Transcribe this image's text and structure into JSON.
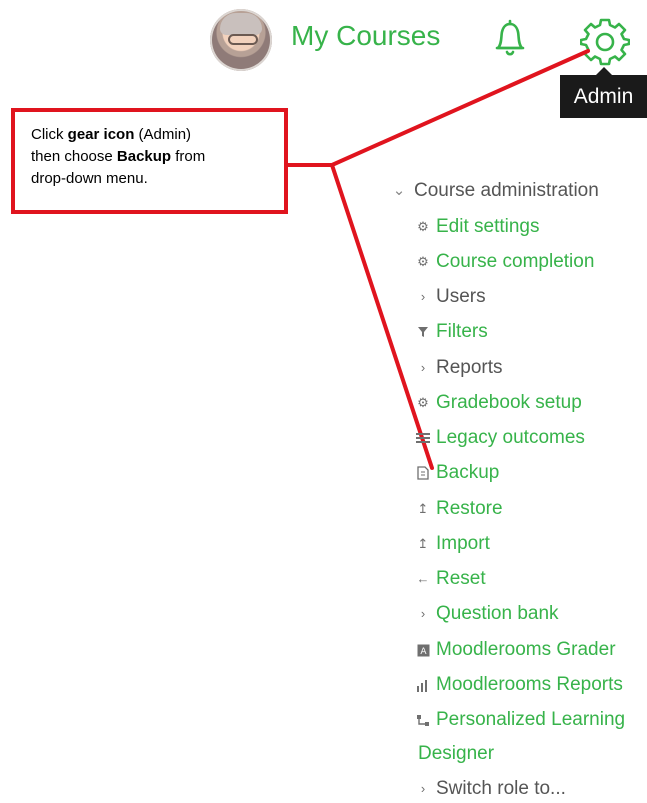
{
  "header": {
    "brand": "My Courses",
    "tooltip": "Admin"
  },
  "callout": {
    "line1_prefix": "Click ",
    "line1_bold": "gear icon",
    "line1_suffix": " (Admin)",
    "line2_prefix": "then choose ",
    "line2_bold": "Backup",
    "line2_suffix": " from",
    "line3": "drop-down menu."
  },
  "menu": {
    "title": "Course administration",
    "items": [
      {
        "label": "Edit settings",
        "icon": "gear-icon"
      },
      {
        "label": "Course completion",
        "icon": "gear-icon"
      },
      {
        "label": "Users",
        "icon": "chevron-right-icon"
      },
      {
        "label": "Filters",
        "icon": "filter-icon"
      },
      {
        "label": "Reports",
        "icon": "chevron-right-icon"
      },
      {
        "label": "Gradebook setup",
        "icon": "gear-icon"
      },
      {
        "label": "Legacy outcomes",
        "icon": "list-icon"
      },
      {
        "label": "Backup",
        "icon": "file-icon"
      },
      {
        "label": "Restore",
        "icon": "upload-icon"
      },
      {
        "label": "Import",
        "icon": "upload-icon"
      },
      {
        "label": "Reset",
        "icon": "arrow-left-icon"
      },
      {
        "label": "Question bank",
        "icon": "chevron-right-icon"
      },
      {
        "label": "Moodlerooms Grader",
        "icon": "grader-icon"
      },
      {
        "label": "Moodlerooms Reports",
        "icon": "bar-chart-icon"
      },
      {
        "label": "Personalized Learning",
        "icon": "flow-icon"
      },
      {
        "label": "Designer"
      },
      {
        "label": "Switch role to...",
        "icon": "chevron-right-icon"
      }
    ]
  },
  "colors": {
    "accent": "#37b34a",
    "annotation": "#e0141e",
    "tooltip_bg": "#1a1a1a",
    "menu_text": "#555555"
  }
}
